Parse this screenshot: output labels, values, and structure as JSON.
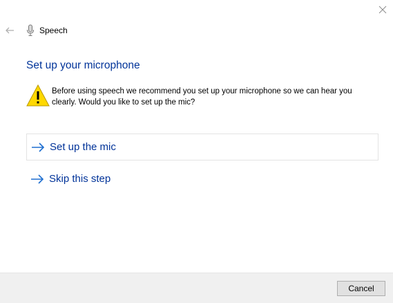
{
  "window": {
    "close_icon": "close-icon"
  },
  "header": {
    "back_icon": "back-arrow-icon",
    "app_icon": "microphone-icon",
    "title": "Speech"
  },
  "main": {
    "heading": "Set up your microphone",
    "warning_icon": "warning-icon",
    "warning_text": "Before using speech we recommend you set up your microphone so we can hear you clearly.  Would you like to set up the mic?",
    "options": [
      {
        "label": "Set up the mic",
        "icon": "right-arrow-icon",
        "selected": true
      },
      {
        "label": "Skip this step",
        "icon": "right-arrow-icon",
        "selected": false
      }
    ]
  },
  "footer": {
    "cancel_label": "Cancel"
  },
  "colors": {
    "heading": "#003399",
    "link": "#003399",
    "arrow": "#1e6fd0",
    "warning_fill": "#ffd800",
    "footer_bg": "#f0f0f0"
  }
}
